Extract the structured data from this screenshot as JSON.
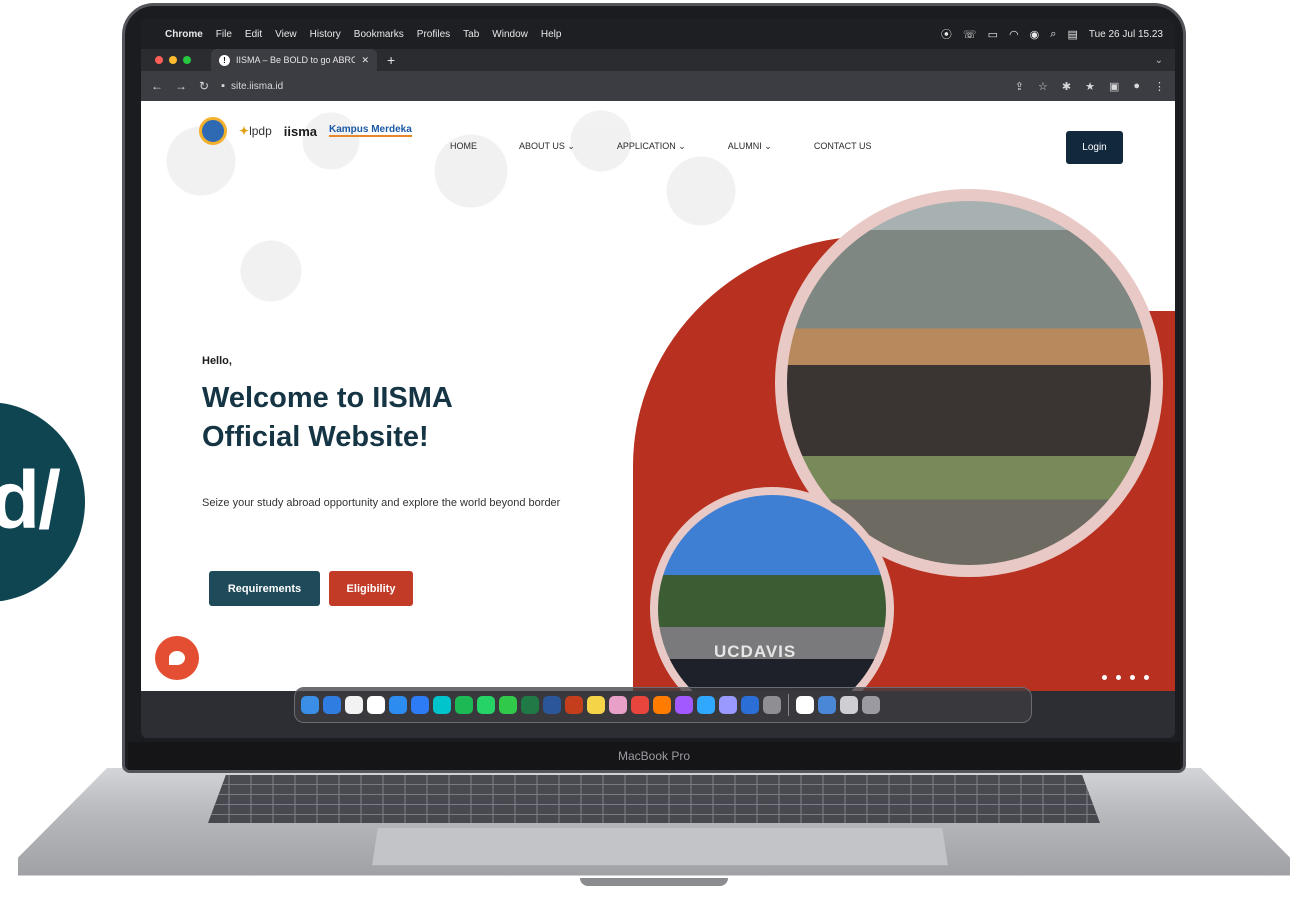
{
  "side_badge": {
    "text": "d/"
  },
  "laptop": {
    "model_label": "MacBook Pro"
  },
  "menubar": {
    "app_name": "Chrome",
    "items": [
      "File",
      "Edit",
      "View",
      "History",
      "Bookmarks",
      "Profiles",
      "Tab",
      "Window",
      "Help"
    ],
    "clock": "Tue 26 Jul  15.23"
  },
  "browser": {
    "tab_title": "IISMA – Be BOLD to go ABROA",
    "url": "site.iisma.id",
    "traffic_colors": [
      "#ff5f57",
      "#febc2e",
      "#28c840"
    ]
  },
  "site": {
    "logos": {
      "lpdp": "lpdp",
      "iisma": "iisma",
      "kampus_merdeka": "Kampus Merdeka"
    },
    "nav": [
      {
        "label": "HOME"
      },
      {
        "label": "ABOUT US ⌄"
      },
      {
        "label": "APPLICATION ⌄"
      },
      {
        "label": "ALUMNI ⌄"
      },
      {
        "label": "CONTACT US"
      }
    ],
    "login_label": "Login",
    "hero": {
      "greeting": "Hello,",
      "title": "Welcome to IISMA Official Website!",
      "subtitle": "Seize your study abroad opportunity and explore the world beyond border",
      "btn_requirements": "Requirements",
      "btn_eligibility": "Eligibility",
      "photo_small_caption": "UCDAVIS"
    },
    "colors": {
      "navy": "#11283d",
      "teal": "#1f4a59",
      "red": "#c23b27"
    }
  },
  "dock": {
    "apps": [
      "finder-icon",
      "safari-icon",
      "notes-icon",
      "notion-icon",
      "app-store-icon",
      "zoom-icon",
      "canva-icon",
      "spotify-icon",
      "whatsapp-icon",
      "facetime-icon",
      "excel-icon",
      "word-icon",
      "powerpoint-icon",
      "notes-yellow-icon",
      "photos-icon",
      "chrome-icon",
      "illustrator-icon",
      "figma-icon",
      "photoshop-icon",
      "after-effects-icon",
      "preview-icon",
      "settings-icon",
      "calendar-icon",
      "photos-stack-icon",
      "dictionary-icon",
      "trash-icon"
    ],
    "app_colors": [
      "#3a8ee6",
      "#2f7de0",
      "#f2f2f2",
      "#ffffff",
      "#2d8cf0",
      "#2d7cf6",
      "#00c4cc",
      "#1db954",
      "#25d366",
      "#31c94a",
      "#1f7a45",
      "#2b579a",
      "#c43e1c",
      "#f5d547",
      "#e8a0c8",
      "#e8453c",
      "#ff7c00",
      "#a259ff",
      "#31a8ff",
      "#9999ff",
      "#2b6fd6",
      "#8e8e93",
      "#ffffff",
      "#4a87d6",
      "#cfcfd3",
      "#9a9aa0"
    ]
  }
}
